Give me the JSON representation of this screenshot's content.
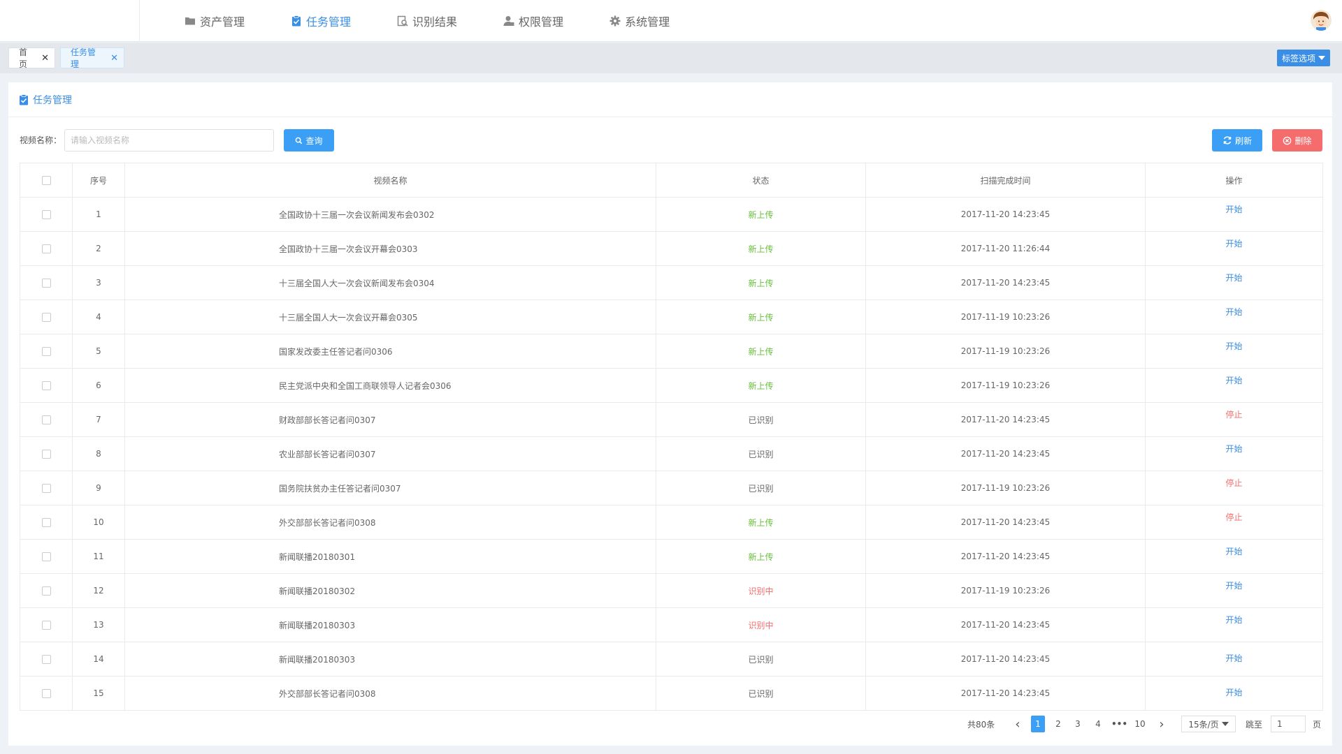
{
  "nav": {
    "items": [
      {
        "label": "资产管理",
        "icon": "folder-icon",
        "active": false
      },
      {
        "label": "任务管理",
        "icon": "clipboard-check-icon",
        "active": true
      },
      {
        "label": "识别结果",
        "icon": "search-doc-icon",
        "active": false
      },
      {
        "label": "权限管理",
        "icon": "user-lock-icon",
        "active": false
      },
      {
        "label": "系统管理",
        "icon": "gear-icon",
        "active": false
      }
    ]
  },
  "tags": {
    "items": [
      {
        "label": "首页",
        "close": "✕"
      },
      {
        "label": "任务管理",
        "close": "✕"
      }
    ],
    "options_label": "标签选项"
  },
  "panel": {
    "title": "任务管理"
  },
  "search": {
    "label": "视频名称：",
    "placeholder": "请输入视频名称",
    "query_label": "查询",
    "refresh_label": "刷新",
    "delete_label": "删除"
  },
  "table": {
    "headers": [
      "序号",
      "视频名称",
      "状态",
      "扫描完成时间",
      "操作"
    ],
    "rows": [
      {
        "no": "1",
        "name": "全国政协十三届一次会议新闻发布会0302",
        "status": "新上传",
        "status_type": "new",
        "time": "2017-11-20 14:23:45",
        "op": "开始",
        "op_type": "start"
      },
      {
        "no": "2",
        "name": "全国政协十三届一次会议开幕会0303",
        "status": "新上传",
        "status_type": "new",
        "time": "2017-11-20 11:26:44",
        "op": "开始",
        "op_type": "start"
      },
      {
        "no": "3",
        "name": "十三届全国人大一次会议新闻发布会0304",
        "status": "新上传",
        "status_type": "new",
        "time": "2017-11-20 14:23:45",
        "op": "开始",
        "op_type": "start"
      },
      {
        "no": "4",
        "name": "十三届全国人大一次会议开幕会0305",
        "status": "新上传",
        "status_type": "new",
        "time": "2017-11-19 10:23:26",
        "op": "开始",
        "op_type": "start"
      },
      {
        "no": "5",
        "name": "国家发改委主任答记者问0306",
        "status": "新上传",
        "status_type": "new",
        "time": "2017-11-19 10:23:26",
        "op": "开始",
        "op_type": "start"
      },
      {
        "no": "6",
        "name": "民主党派中央和全国工商联领导人记者会0306",
        "status": "新上传",
        "status_type": "new",
        "time": "2017-11-19 10:23:26",
        "op": "开始",
        "op_type": "start"
      },
      {
        "no": "7",
        "name": "财政部部长答记者问0307",
        "status": "已识别",
        "status_type": "done",
        "time": "2017-11-20 14:23:45",
        "op": "停止",
        "op_type": "stop"
      },
      {
        "no": "8",
        "name": "农业部部长答记者问0307",
        "status": "已识别",
        "status_type": "done",
        "time": "2017-11-20 14:23:45",
        "op": "开始",
        "op_type": "start"
      },
      {
        "no": "9",
        "name": "国务院扶贫办主任答记者问0307",
        "status": "已识别",
        "status_type": "done",
        "time": "2017-11-19 10:23:26",
        "op": "停止",
        "op_type": "stop"
      },
      {
        "no": "10",
        "name": "外交部部长答记者问0308",
        "status": "新上传",
        "status_type": "new",
        "time": "2017-11-20 14:23:45",
        "op": "停止",
        "op_type": "stop"
      },
      {
        "no": "11",
        "name": "新闻联播20180301",
        "status": "新上传",
        "status_type": "new",
        "time": "2017-11-20 14:23:45",
        "op": "开始",
        "op_type": "start"
      },
      {
        "no": "12",
        "name": "新闻联播20180302",
        "status": "识别中",
        "status_type": "ing",
        "time": "2017-11-19 10:23:26",
        "op": "开始",
        "op_type": "start"
      },
      {
        "no": "13",
        "name": "新闻联播20180303",
        "status": "识别中",
        "status_type": "ing",
        "time": "2017-11-20 14:23:45",
        "op": "开始",
        "op_type": "start"
      },
      {
        "no": "14",
        "name": "新闻联播20180303",
        "status": "已识别",
        "status_type": "done",
        "time": "2017-11-20 14:23:45",
        "op": "开始",
        "op_type": "start"
      },
      {
        "no": "15",
        "name": "外交部部长答记者问0308",
        "status": "已识别",
        "status_type": "done",
        "time": "2017-11-20 14:23:45",
        "op": "开始",
        "op_type": "start"
      }
    ]
  },
  "pager": {
    "total": "共80条",
    "prev": "‹",
    "pages": [
      "1",
      "2",
      "3",
      "4",
      "•••",
      "10"
    ],
    "current": "1",
    "next": "›",
    "page_size": "15条/页",
    "goto_label": "跳至",
    "goto_value": "1",
    "page_label": "页"
  },
  "colors": {
    "accent": "#3a8ee6",
    "primary_button": "#3a9ff5",
    "danger": "#f56c6c",
    "status_new": "#67c23a"
  }
}
